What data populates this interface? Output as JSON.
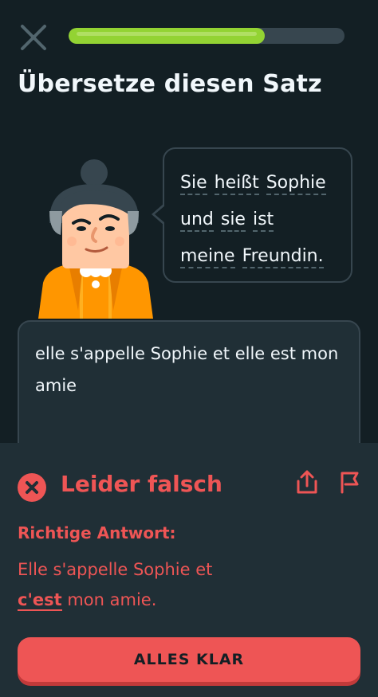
{
  "progress": {
    "fraction": 0.71
  },
  "header": {
    "title": "Übersetze diesen Satz"
  },
  "prompt": {
    "lines": [
      [
        "Sie",
        "heißt",
        "Sophie"
      ],
      [
        "und",
        "sie",
        "ist"
      ],
      [
        "meine",
        "Freundin."
      ]
    ]
  },
  "answer": {
    "text": "elle s'appelle Sophie et elle est mon amie"
  },
  "feedback": {
    "title": "Leider falsch",
    "correct_label": "Richtige Antwort:",
    "correct_line1": "Elle s'appelle Sophie et",
    "correct_highlight": "c'est",
    "correct_rest": " mon amie.",
    "button_label": "ALLES KLAR"
  },
  "colors": {
    "background": "#131f24",
    "panel": "#202f36",
    "progress_fill": "#93d333",
    "error": "#ee5555"
  },
  "icons": {
    "close": "close-icon",
    "share": "share-icon",
    "flag": "flag-icon",
    "error": "x-circle-icon"
  }
}
